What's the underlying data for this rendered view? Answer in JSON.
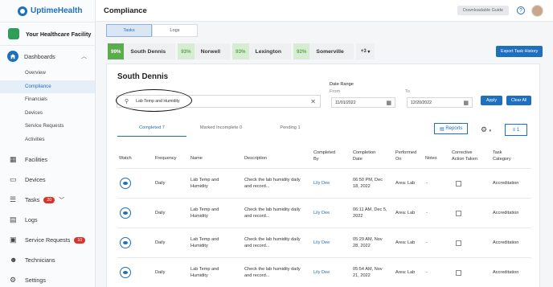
{
  "brand": {
    "name": "UptimeHealth"
  },
  "facility": {
    "name": "Your Healthcare Facility"
  },
  "sidebar": {
    "dashboards": "Dashboards",
    "sub_items": [
      "Overview",
      "Compliance",
      "Financials",
      "Devices",
      "Service Requests",
      "Activities"
    ],
    "items": [
      {
        "label": "Facilities",
        "icon": "building-icon"
      },
      {
        "label": "Devices",
        "icon": "devices-icon"
      },
      {
        "label": "Tasks",
        "icon": "tasks-icon",
        "badge": "20"
      },
      {
        "label": "Logs",
        "icon": "logs-icon"
      },
      {
        "label": "Service Requests",
        "icon": "service-icon",
        "badge": "10"
      },
      {
        "label": "Technicians",
        "icon": "people-icon"
      },
      {
        "label": "Settings",
        "icon": "gear-icon"
      }
    ]
  },
  "header": {
    "title": "Compliance",
    "download_guide": "Downloadable Guide"
  },
  "top_tabs": [
    "Tasks",
    "Logs"
  ],
  "facilities": [
    {
      "pct": "99%",
      "name": "South Dennis"
    },
    {
      "pct": "93%",
      "name": "Norwell"
    },
    {
      "pct": "93%",
      "name": "Lexington"
    },
    {
      "pct": "92%",
      "name": "Somerville"
    }
  ],
  "more_facilities": "+3",
  "export_label": "Export Task History",
  "panel": {
    "title": "South Dennis",
    "search_value": "Lab Temp and Humidity",
    "date_range": "Date Range",
    "from_label": "From",
    "to_label": "To",
    "from_date": "11/01/2022",
    "to_date": "12/20/2022",
    "apply": "Apply",
    "clear_all": "Clear All",
    "tabs": [
      "Completed 7",
      "Marked Incomplete 0",
      "Pending 1"
    ],
    "reports": "Reports",
    "filter_count": "1"
  },
  "table": {
    "headers": {
      "watch": "Watch",
      "frequency": "Frequency",
      "name": "Name",
      "description": "Description",
      "completed_by": [
        "Completed",
        "By"
      ],
      "completion_date": [
        "Completion",
        "Date"
      ],
      "performed_on": [
        "Performed",
        "On"
      ],
      "notes": "Notes",
      "corrective": [
        "Corrective",
        "Action Taken"
      ],
      "category": [
        "Task",
        "Category"
      ]
    },
    "rows": [
      {
        "frequency": "Daily",
        "name": [
          "Lab Temp and",
          "Humidity"
        ],
        "description": [
          "Check the lab humidity daily",
          "and record..."
        ],
        "completed_by": "Lily Dee",
        "date": [
          "06:50 PM, Dec",
          "18, 2022"
        ],
        "performed": "Area: Lab",
        "notes": "-",
        "category": "Accreditation"
      },
      {
        "frequency": "Daily",
        "name": [
          "Lab Temp and",
          "Humidity"
        ],
        "description": [
          "Check the lab humidity daily",
          "and record..."
        ],
        "completed_by": "Lily Dee",
        "date": [
          "06:11 AM, Dec 5,",
          "2022"
        ],
        "performed": "Area: Lab",
        "notes": "-",
        "category": "Accreditation"
      },
      {
        "frequency": "Daily",
        "name": [
          "Lab Temp and",
          "Humidity"
        ],
        "description": [
          "Check the lab humidity daily",
          "and record..."
        ],
        "completed_by": "Lily Dee",
        "date": [
          "05:29 AM, Nov",
          "28, 2022"
        ],
        "performed": "Area: Lab",
        "notes": "-",
        "category": "Accreditation"
      },
      {
        "frequency": "Daily",
        "name": [
          "Lab Temp and",
          "Humidity"
        ],
        "description": [
          "Check the lab humidity daily",
          "and record..."
        ],
        "completed_by": "Lily Dee",
        "date": [
          "05:54 AM, Nov",
          "21, 2022"
        ],
        "performed": "Area: Lab",
        "notes": "-",
        "category": "Accreditation"
      }
    ]
  }
}
